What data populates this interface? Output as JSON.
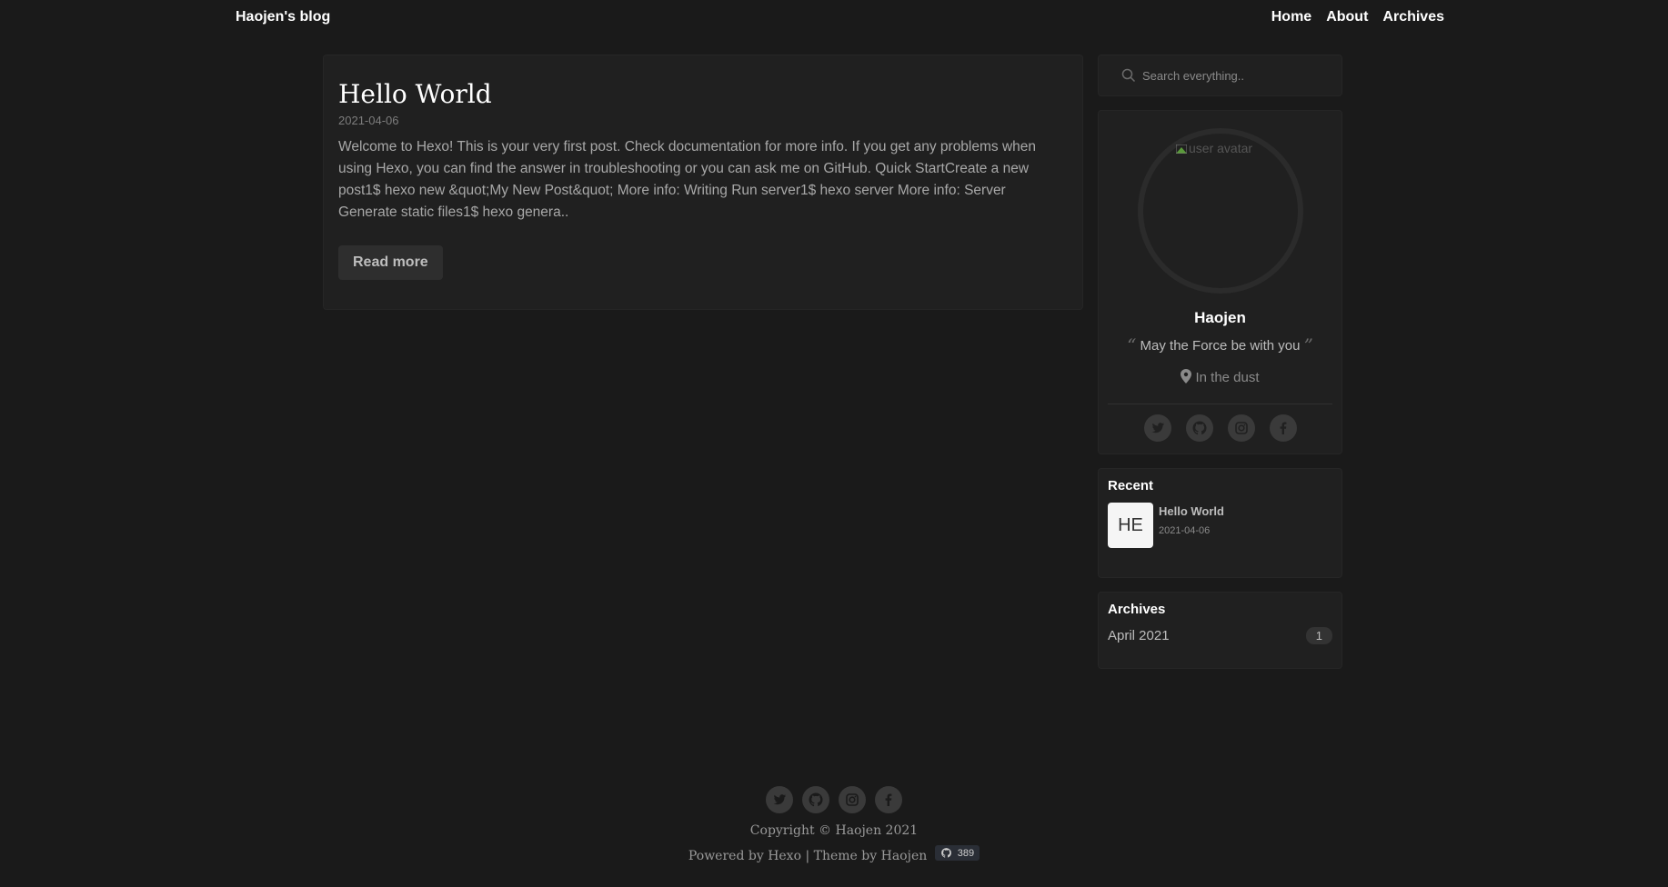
{
  "header": {
    "brand": "Haojen's blog",
    "nav": [
      "Home",
      "About",
      "Archives"
    ]
  },
  "post": {
    "title": "Hello World",
    "date": "2021-04-06",
    "excerpt": "Welcome to Hexo! This is your very first post. Check documentation for more info. If you get any problems when using Hexo, you can find the answer in troubleshooting or you can ask me on GitHub. Quick StartCreate a new post1$ hexo new &quot;My New Post&quot; More info: Writing Run server1$ hexo server More info: Server Generate static files1$ hexo genera..",
    "read_more": "Read more"
  },
  "search": {
    "placeholder": "Search everything.."
  },
  "profile": {
    "avatar_alt": "user avatar",
    "name": "Haojen",
    "motto": "May the Force be with you",
    "location": "In the dust",
    "social": [
      "twitter-icon",
      "github-icon",
      "instagram-icon",
      "facebook-icon"
    ]
  },
  "recent": {
    "heading": "Recent",
    "items": [
      {
        "thumb": "HE",
        "title": "Hello World",
        "date": "2021-04-06"
      }
    ]
  },
  "archives": {
    "heading": "Archives",
    "items": [
      {
        "month": "April 2021",
        "count": "1"
      }
    ]
  },
  "footer": {
    "copyright": "Copyright © Haojen 2021",
    "powered_prefix": "Powered by",
    "powered_link": "Hexo",
    "separator": "|",
    "theme_prefix": "Theme by",
    "theme_link": "Haojen",
    "stars": "389"
  },
  "colors": {
    "background": "#1a1a1a",
    "card": "#202020",
    "text": "#cfcfcf"
  }
}
